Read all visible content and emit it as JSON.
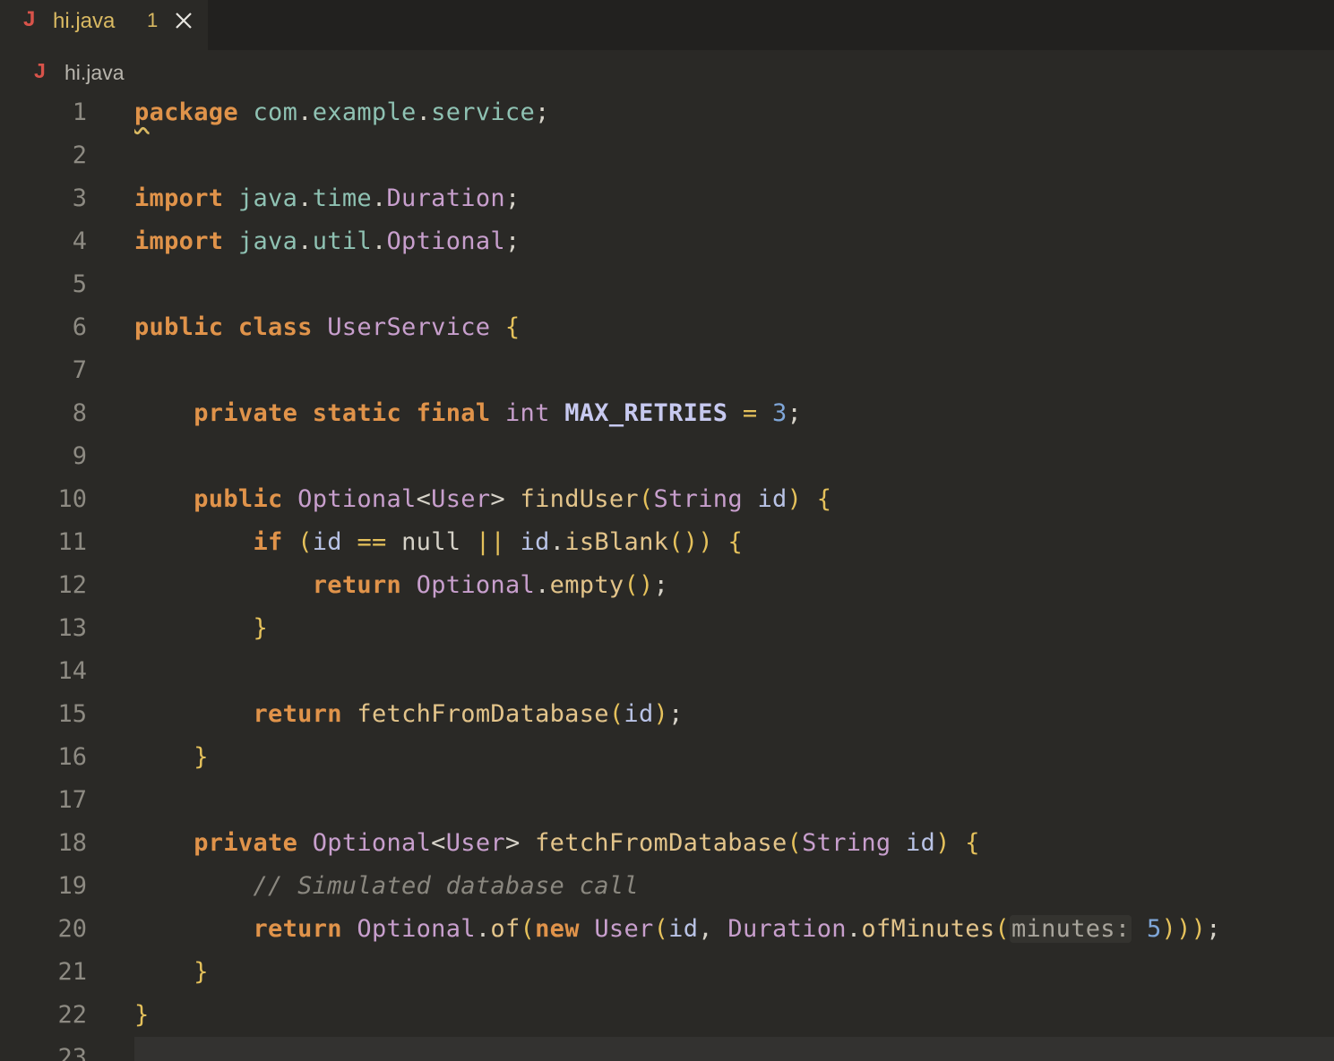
{
  "tab": {
    "icon": "J",
    "filename": "hi.java",
    "problem_count": "1"
  },
  "breadcrumb": {
    "icon": "J",
    "filename": "hi.java"
  },
  "code": {
    "line_numbers": [
      "1",
      "2",
      "3",
      "4",
      "5",
      "6",
      "7",
      "8",
      "9",
      "10",
      "11",
      "12",
      "13",
      "14",
      "15",
      "16",
      "17",
      "18",
      "19",
      "20",
      "21",
      "22",
      "23"
    ],
    "lines": [
      "package com.example.service;",
      "",
      "import java.time.Duration;",
      "import java.util.Optional;",
      "",
      "public class UserService {",
      "",
      "    private static final int MAX_RETRIES = 3;",
      "",
      "    public Optional<User> findUser(String id) {",
      "        if (id == null || id.isBlank()) {",
      "            return Optional.empty();",
      "        }",
      "",
      "        return fetchFromDatabase(id);",
      "    }",
      "",
      "    private Optional<User> fetchFromDatabase(String id) {",
      "        // Simulated database call",
      "        return Optional.of(new User(id, Duration.ofMinutes(minutes: 5)));",
      "    }",
      "}",
      ""
    ],
    "inlay_hint": "minutes:"
  },
  "colors": {
    "background": "#2a2926",
    "keyword": "#e0934a",
    "type": "#c89fcd",
    "package": "#8fc2b3",
    "function": "#e3c48a",
    "comment": "#8a877f",
    "java_icon": "#d8534a",
    "tab_text": "#d9b962"
  }
}
